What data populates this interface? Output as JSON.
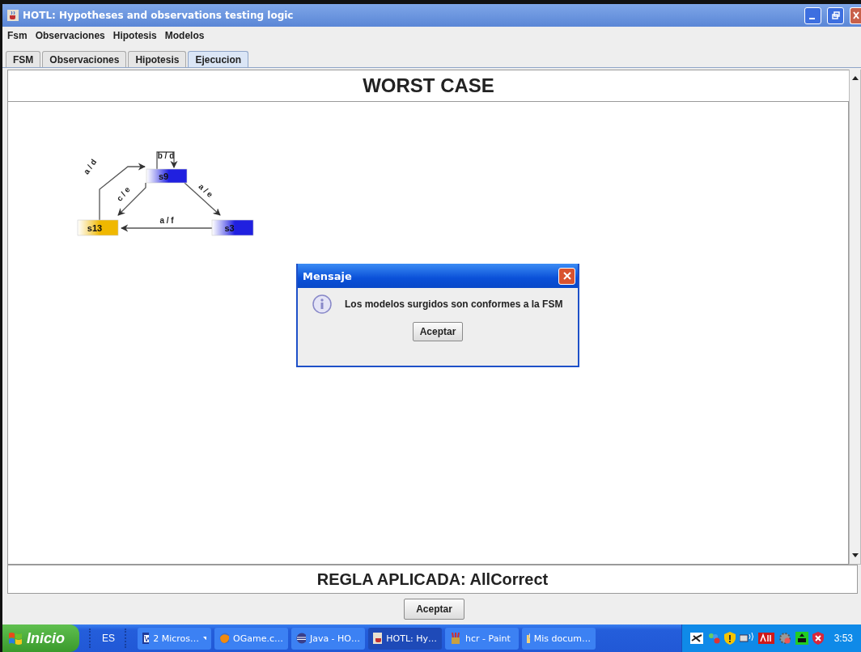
{
  "window": {
    "title": "HOTL: Hypotheses and observations testing logic"
  },
  "menu": [
    "Fsm",
    "Observaciones",
    "Hipotesis",
    "Modelos"
  ],
  "tabs": [
    {
      "label": "FSM",
      "selected": false
    },
    {
      "label": "Observaciones",
      "selected": false
    },
    {
      "label": "Hipotesis",
      "selected": false
    },
    {
      "label": "Ejecucion",
      "selected": true
    }
  ],
  "header": "WORST CASE",
  "diagram": {
    "nodes": [
      {
        "label": "s9",
        "color": "#2020e0"
      },
      {
        "label": "s13",
        "color": "#f0b800"
      },
      {
        "label": "s3",
        "color": "#2020e0"
      }
    ],
    "edges": [
      {
        "label": "a / d"
      },
      {
        "label": "b / d"
      },
      {
        "label": "c / e"
      },
      {
        "label": "a / e"
      },
      {
        "label": "a / f"
      }
    ]
  },
  "rule": "REGLA APLICADA: AllCorrect",
  "button": "Aceptar",
  "dialog": {
    "title": "Mensaje",
    "message": "Los modelos surgidos son conformes a la FSM",
    "button": "Aceptar"
  },
  "taskbar": {
    "start": "Inicio",
    "language": "ES",
    "tasks": [
      {
        "label": "2 Micros…",
        "kind": "word",
        "grouped": true,
        "selected": false
      },
      {
        "label": "OGame.c…",
        "kind": "browser",
        "grouped": false,
        "selected": false
      },
      {
        "label": "Java - HO…",
        "kind": "java",
        "grouped": false,
        "selected": false
      },
      {
        "label": "HOTL: Hy…",
        "kind": "app",
        "grouped": false,
        "selected": true
      },
      {
        "label": "hcr - Paint",
        "kind": "paint",
        "grouped": false,
        "selected": false
      },
      {
        "label": "Mis docum…",
        "kind": "folder",
        "grouped": false,
        "selected": false
      }
    ],
    "clock": "3:53"
  }
}
